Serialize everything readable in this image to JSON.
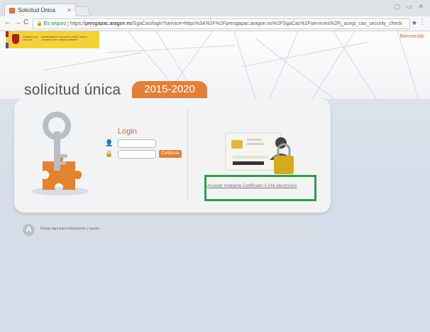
{
  "browser": {
    "tab_title": "Solicitud Única",
    "tab_close": "×",
    "window_controls": "▢ ▭ ✕",
    "nav_back": "←",
    "nav_forward": "→",
    "nav_reload": "C",
    "secure_label": "Es seguro",
    "url_prefix": "https://",
    "url_host": "presgapac.aragon.es",
    "url_path": "/SgaCas/login?service=https%3A%2F%2Fpresgapac.aragon.es%2FSgaCac%2Fservicies%2Fj_acegi_cas_security_check",
    "star": "★",
    "menu": "⋮"
  },
  "header": {
    "logo_text_1": "GOBIERNO DE ARAGON",
    "logo_text_2": "DEPARTAMENTO DE AGRICULTURA Y PESCA ALIMENTACION Y MEDIO AMBIENTE",
    "welcome": "Bienvenido",
    "app_title": "solicitud única",
    "period": "2015-2020"
  },
  "login": {
    "title": "Login",
    "continue": "Continuar",
    "cert_link": "Acceder mediante Certificado ó DNI electrónico"
  },
  "help": {
    "icon_letter": "A",
    "text": "Pulsar aquí para información y ayuda"
  },
  "colors": {
    "accent": "#e38034",
    "highlight": "#2e9e4a"
  }
}
